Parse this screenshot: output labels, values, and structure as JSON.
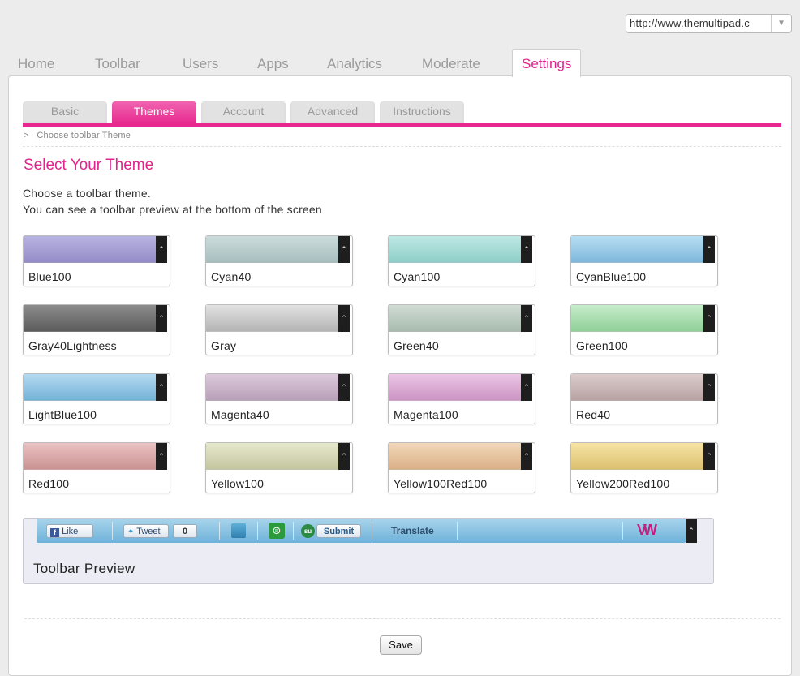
{
  "url_select": {
    "value": "http://www.themultipad.c"
  },
  "main_tabs": [
    {
      "label": "Home"
    },
    {
      "label": "Toolbar"
    },
    {
      "label": "Users"
    },
    {
      "label": "Apps"
    },
    {
      "label": "Analytics"
    },
    {
      "label": "Moderate"
    },
    {
      "label": "Settings",
      "active": true
    }
  ],
  "sub_tabs": [
    {
      "label": "Basic"
    },
    {
      "label": "Themes",
      "active": true
    },
    {
      "label": "Account"
    },
    {
      "label": "Advanced"
    },
    {
      "label": "Instructions"
    }
  ],
  "breadcrumb": {
    "arrow": ">",
    "text": "Choose toolbar Theme"
  },
  "page_title": "Select Your Theme",
  "description": {
    "line1": "Choose a toolbar theme.",
    "line2": "You can see a toolbar preview at the bottom of the screen"
  },
  "themes": [
    {
      "name": "Blue100",
      "top": "#b8b4e0",
      "bottom": "#948cc8"
    },
    {
      "name": "Cyan40",
      "top": "#ccdcdc",
      "bottom": "#a8bebe"
    },
    {
      "name": "Cyan100",
      "top": "#bfe8e4",
      "bottom": "#8ecec8"
    },
    {
      "name": "CyanBlue100",
      "top": "#b8def2",
      "bottom": "#7eb8dc"
    },
    {
      "name": "Gray40Lightness",
      "top": "#8c8c8c",
      "bottom": "#5c5c5c"
    },
    {
      "name": "Gray",
      "top": "#e2e2e2",
      "bottom": "#b4b4b4"
    },
    {
      "name": "Green40",
      "top": "#d0dcd4",
      "bottom": "#a8bcae"
    },
    {
      "name": "Green100",
      "top": "#c6ecca",
      "bottom": "#90d098"
    },
    {
      "name": "LightBlue100",
      "top": "#b4daf0",
      "bottom": "#74b2d8"
    },
    {
      "name": "Magenta40",
      "top": "#dccadc",
      "bottom": "#b8a0b8"
    },
    {
      "name": "Magenta100",
      "top": "#ecc6e6",
      "bottom": "#cc94c4"
    },
    {
      "name": "Red40",
      "top": "#dccccc",
      "bottom": "#b8a2a2"
    },
    {
      "name": "Red100",
      "top": "#ecc2c2",
      "bottom": "#ca9292"
    },
    {
      "name": "Yellow100",
      "top": "#e6e8cc",
      "bottom": "#c4c6a0"
    },
    {
      "name": "Yellow100Red100",
      "top": "#f2d8b8",
      "bottom": "#dab088"
    },
    {
      "name": "Yellow200Red100",
      "top": "#f6e4a4",
      "bottom": "#dcc070"
    }
  ],
  "preview": {
    "like_label": "Like",
    "tweet_label": "Tweet",
    "tweet_count": "0",
    "submit_label": "Submit",
    "translate_label": "Translate",
    "caption": "Toolbar Preview"
  },
  "chevron_glyph": "⌃",
  "save_label": "Save",
  "colors": {
    "accent": "#e0248c"
  }
}
